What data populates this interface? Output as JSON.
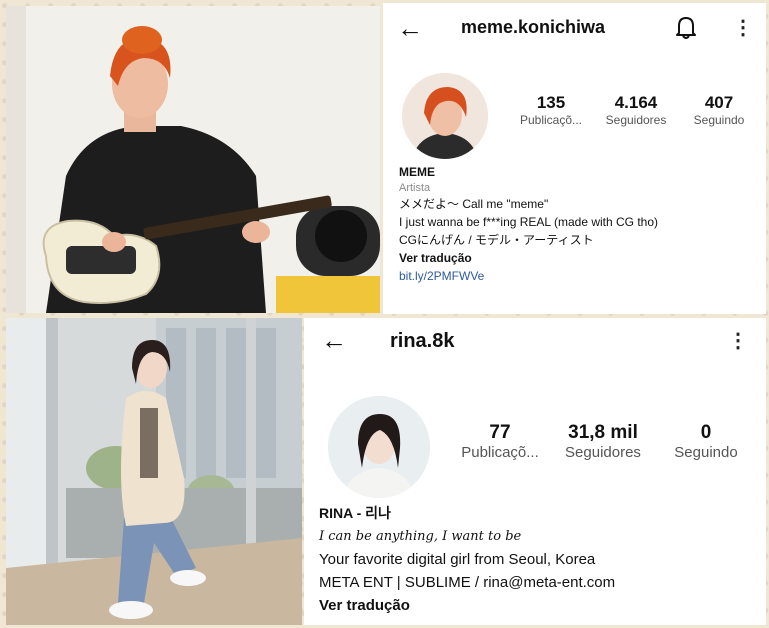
{
  "profile1": {
    "back_icon": "arrow-left-icon",
    "username": "meme.konichiwa",
    "bell_icon": "bell-icon",
    "menu_icon": "more-vertical-icon",
    "menu_glyph": "⋮",
    "stats": [
      {
        "num": "135",
        "label": "Publicaçõ..."
      },
      {
        "num": "4.164",
        "label": "Seguidores"
      },
      {
        "num": "407",
        "label": "Seguindo"
      }
    ],
    "bio": {
      "name": "MEME",
      "category": "Artista",
      "line1": "メメだよ～ Call me \"meme\"",
      "line2": "I just wanna be f***ing REAL (made with CG tho)",
      "line3": "CGにんげん / モデル・アーティスト",
      "translate": "Ver tradução",
      "link": "bit.ly/2PMFWVe"
    }
  },
  "profile2": {
    "back_icon": "arrow-left-icon",
    "username": "rina.8k",
    "menu_icon": "more-vertical-icon",
    "menu_glyph": "⋮",
    "stats": [
      {
        "num": "77",
        "label": "Publicaçõ..."
      },
      {
        "num": "31,8 mil",
        "label": "Seguidores"
      },
      {
        "num": "0",
        "label": "Seguindo"
      }
    ],
    "bio": {
      "name": "RINA - 리나",
      "tagline": "I can be anything, I want to be",
      "line1": "Your favorite digital girl from Seoul, Korea",
      "line2": "META ENT | SUBLIME / rina@meta-ent.com",
      "translate": "Ver tradução"
    }
  },
  "colors": {
    "background": "#efe6d3",
    "link": "#2d5a9c",
    "muted": "#8a8a8a"
  }
}
